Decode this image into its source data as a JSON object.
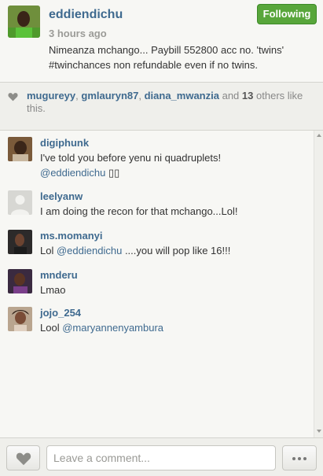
{
  "post": {
    "username": "eddiendichu",
    "follow_label": "Following",
    "time": "3 hours ago",
    "caption": "Nimeanza mchango... Paybill 552800 acc no. 'twins' #twinchances non refundable even if no twins."
  },
  "likes": {
    "users": [
      "mugureyy",
      "gmlauryn87",
      "diana_mwanzia"
    ],
    "and_label": "and",
    "count": "13",
    "others_label": "others like this."
  },
  "comments": [
    {
      "username": "digiphunk",
      "text": "I've told you before yenu ni quadruplets!",
      "mention": "@eddiendichu",
      "trailing": "▯▯"
    },
    {
      "username": "leelyanw",
      "text": "I am doing the recon for that mchango...Lol!"
    },
    {
      "username": "ms.momanyi",
      "prefix": "Lol",
      "mention": "@eddiendichu",
      "text": "....you will pop like 16!!!"
    },
    {
      "username": "mnderu",
      "text": "Lmao"
    },
    {
      "username": "jojo_254",
      "prefix": "Lool",
      "mention": "@maryannenyambura"
    }
  ],
  "footer": {
    "comment_placeholder": "Leave a comment..."
  },
  "colors": {
    "link": "#3f6a8f",
    "following_green": "#58a63b"
  },
  "icons": {
    "like": "heart-icon",
    "more": "ellipsis-icon"
  }
}
